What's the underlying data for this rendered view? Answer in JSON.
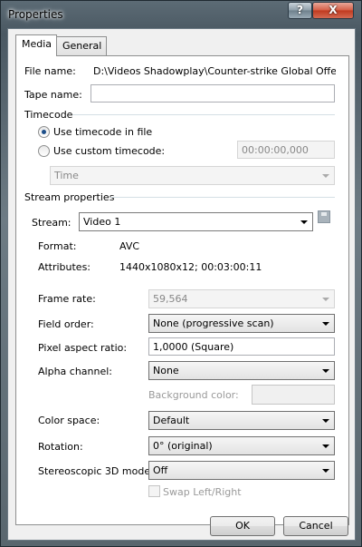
{
  "window": {
    "title": "Properties",
    "help_label": "?",
    "close_label": "X"
  },
  "tabs": [
    {
      "label": "Media"
    },
    {
      "label": "General"
    }
  ],
  "file": {
    "label": "File name:",
    "value": "D:\\Videos Shadowplay\\Counter-strike  Global Offensive\\"
  },
  "tape": {
    "label": "Tape name:",
    "value": ""
  },
  "timecode": {
    "heading": "Timecode",
    "use_file_label": "Use timecode in file",
    "use_custom_label": "Use custom timecode:",
    "custom_value": "00:00:00,000",
    "format_value": "Time"
  },
  "stream": {
    "heading": "Stream properties",
    "label": "Stream:",
    "value": "Video 1",
    "format_label": "Format:",
    "format_value": "AVC",
    "attributes_label": "Attributes:",
    "attributes_value": "1440x1080x12; 00:03:00:11"
  },
  "props": {
    "frame_rate_label": "Frame rate:",
    "frame_rate_value": "59,564",
    "field_order_label": "Field order:",
    "field_order_value": "None (progressive scan)",
    "pixel_aspect_label": "Pixel aspect ratio:",
    "pixel_aspect_value": "1,0000 (Square)",
    "alpha_label": "Alpha channel:",
    "alpha_value": "None",
    "bg_color_label": "Background color:",
    "color_space_label": "Color space:",
    "color_space_value": "Default",
    "rotation_label": "Rotation:",
    "rotation_value": "0° (original)",
    "stereo_label": "Stereoscopic 3D mode:",
    "stereo_value": "Off",
    "swap_label": "Swap Left/Right"
  },
  "footer": {
    "ok_label": "OK",
    "cancel_label": "Cancel"
  }
}
